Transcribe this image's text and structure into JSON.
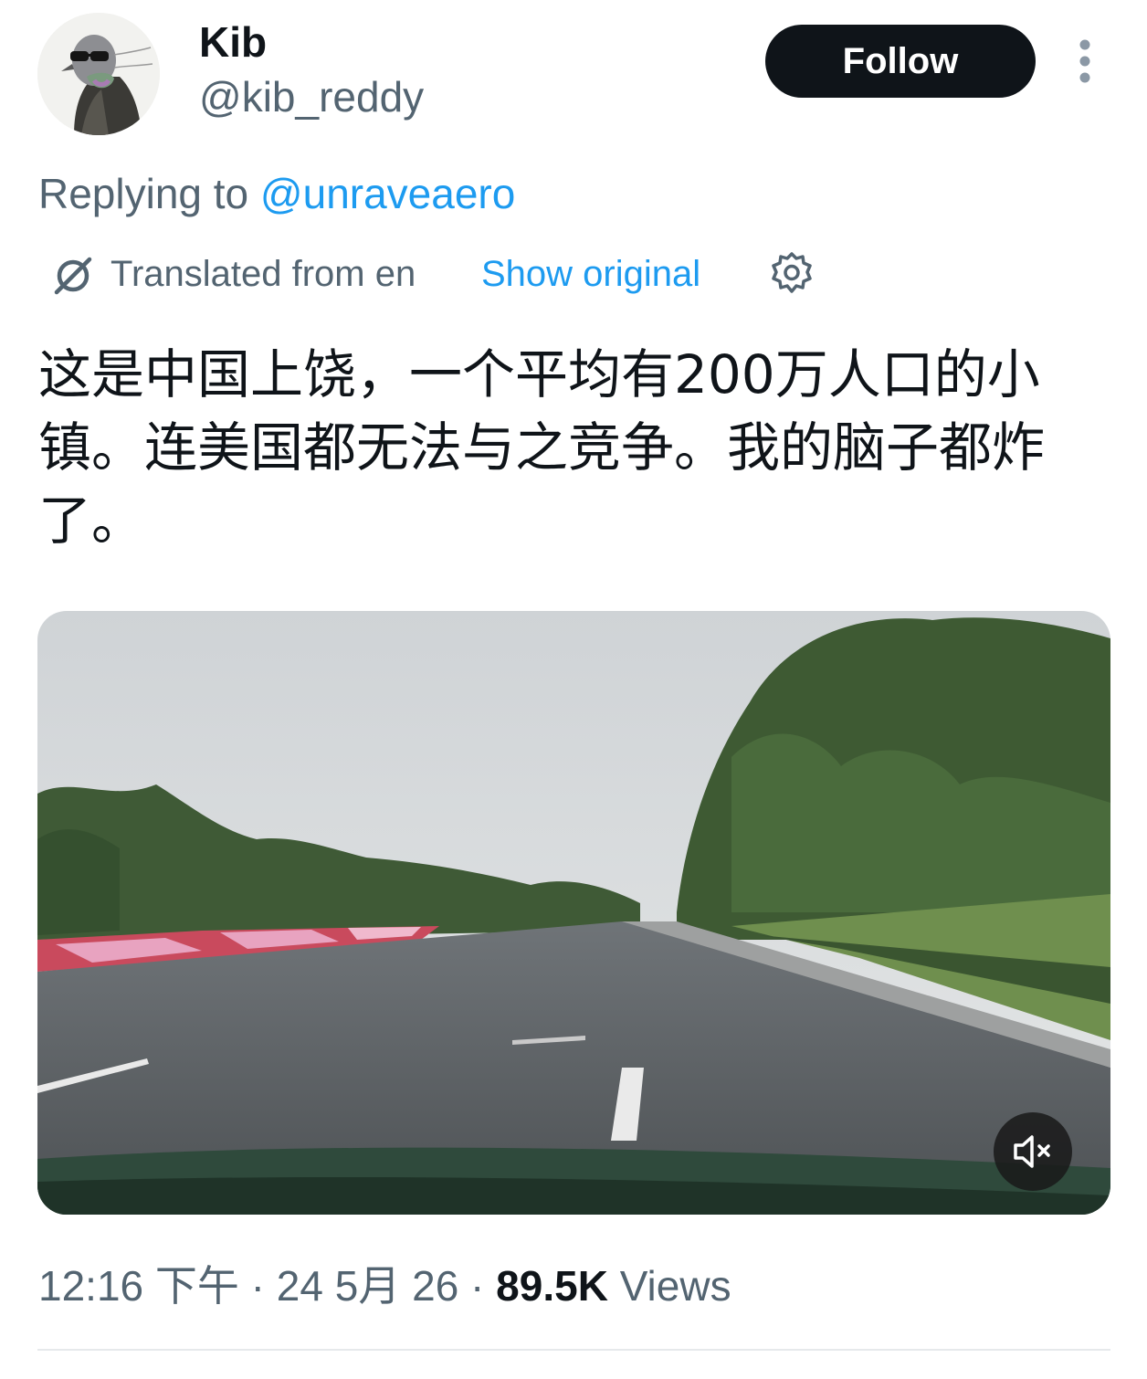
{
  "author": {
    "display_name": "Kib",
    "handle": "@kib_reddy"
  },
  "follow_button": {
    "label": "Follow"
  },
  "reply": {
    "prefix": "Replying to ",
    "mention": "@unraveaero"
  },
  "translation": {
    "label": "Translated from en",
    "show_original": "Show original"
  },
  "tweet": {
    "text": "这是中国上饶，一个平均有200万人口的小镇。连美国都无法与之竞争。我的脑子都炸了。"
  },
  "meta": {
    "time": "12:16 下午",
    "separator": " · ",
    "date": "24 5月 26",
    "views_count": "89.5K",
    "views_label": " Views"
  },
  "icons": {
    "more": "more-vertical-icon",
    "translate": "translate-icon",
    "settings": "gear-icon",
    "mute": "speaker-muted-icon"
  },
  "colors": {
    "accent": "#1d9bf0",
    "text": "#0f1419",
    "secondary": "#536471",
    "button": "#0f1419"
  }
}
